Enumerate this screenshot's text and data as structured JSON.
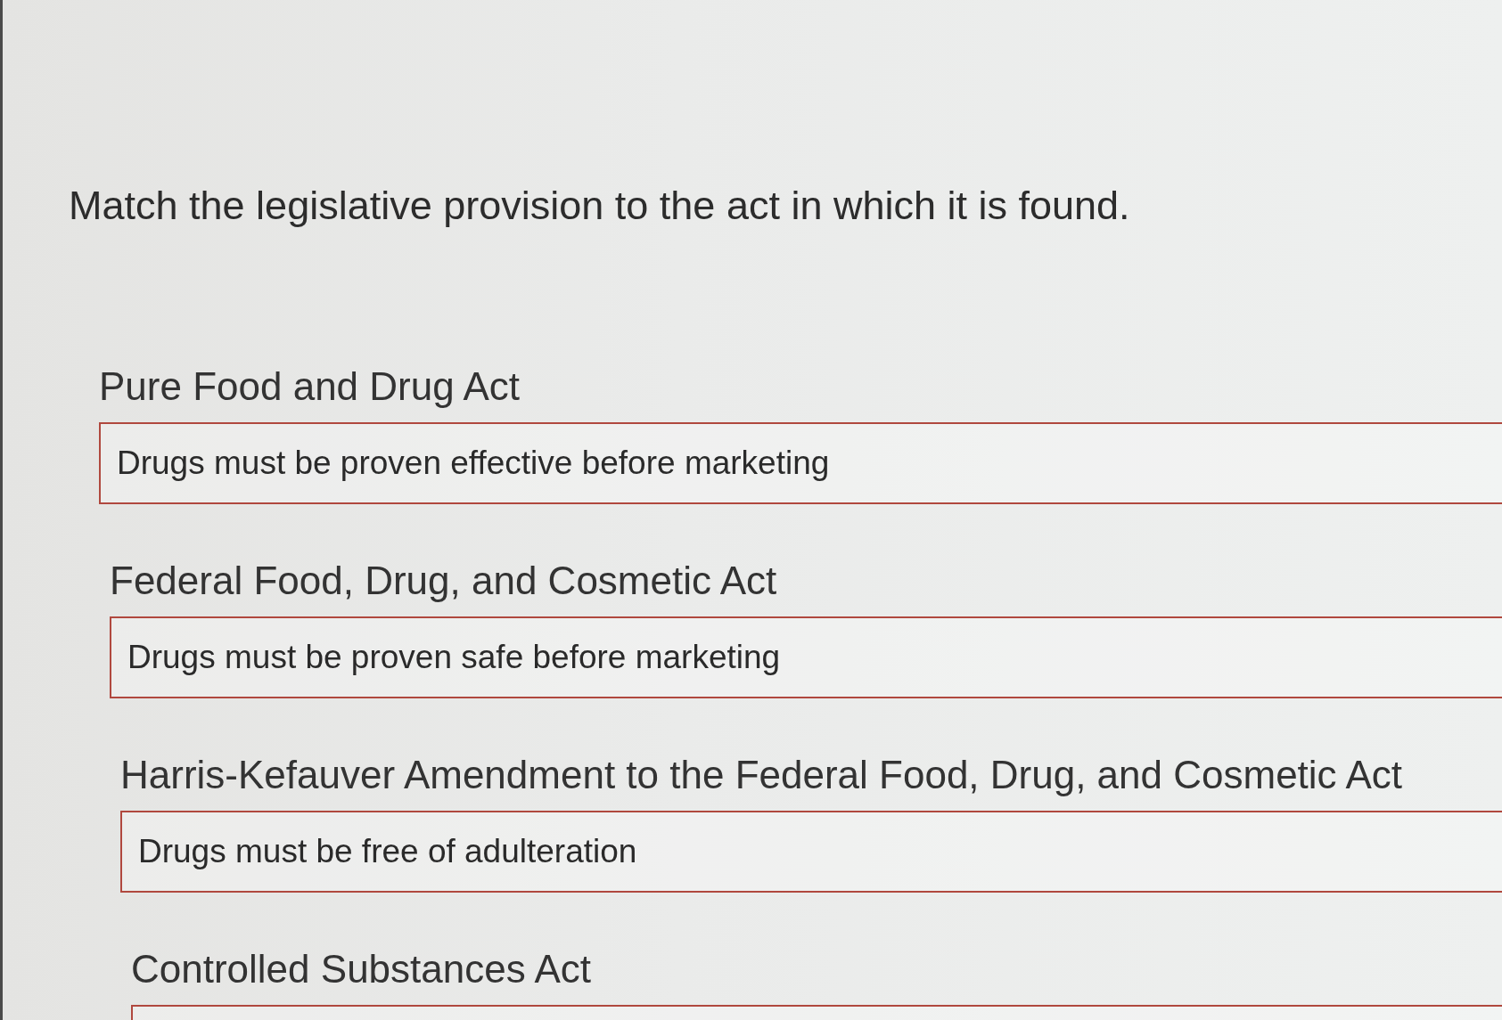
{
  "question": {
    "prompt": "Match the legislative provision to the act in which it is found."
  },
  "matches": [
    {
      "act": "Pure Food and Drug Act",
      "answer": "Drugs must be proven effective before marketing"
    },
    {
      "act": "Federal Food, Drug, and Cosmetic Act",
      "answer": "Drugs must be proven safe before marketing"
    },
    {
      "act": "Harris-Kefauver Amendment to the Federal Food, Drug, and Cosmetic Act",
      "answer": "Drugs must be free of adulteration"
    },
    {
      "act": "Controlled Substances Act"
    }
  ]
}
